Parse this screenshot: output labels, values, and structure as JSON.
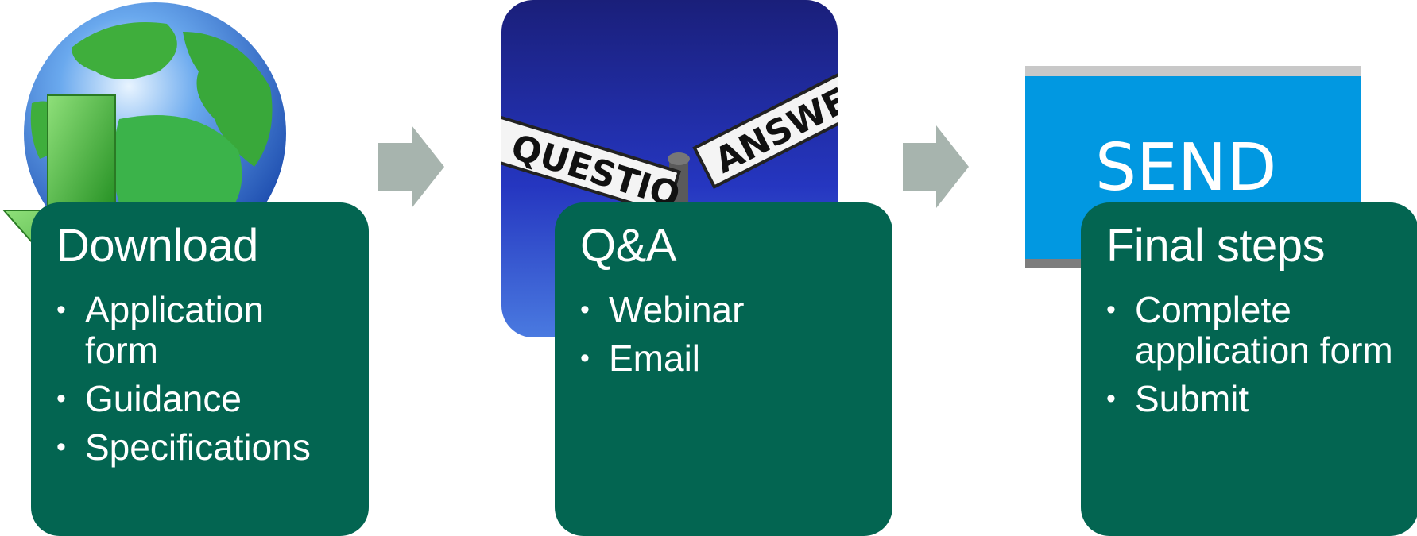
{
  "steps": [
    {
      "title": "Download",
      "items": [
        "Application form",
        "Guidance",
        "Specifications"
      ],
      "image_icon": "globe-download-icon"
    },
    {
      "title": "Q&A",
      "items": [
        "Webinar",
        "Email"
      ],
      "image_icon": "question-answer-signpost"
    },
    {
      "title": "Final steps",
      "items": [
        "Complete application form",
        "Submit"
      ],
      "image_icon": "send-button-image"
    }
  ],
  "images": {
    "signpost_left": "QUESTIO",
    "signpost_right": "ANSWER",
    "send_label": "SEND"
  },
  "colors": {
    "card": "#036551",
    "arrow": "#a7b4ae",
    "send_blue": "#0198e1",
    "sky_top": "#1a1f7a",
    "sky_bottom": "#4a7ae0"
  }
}
